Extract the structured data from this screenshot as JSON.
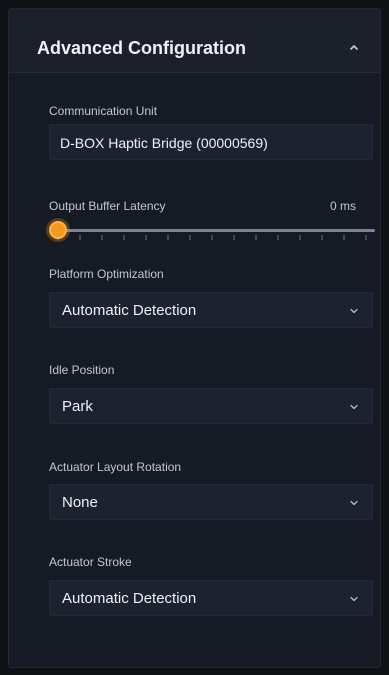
{
  "header": {
    "title": "Advanced Configuration",
    "collapse_icon": "chevron-up-icon"
  },
  "communication_unit": {
    "label": "Communication Unit",
    "value": "D-BOX Haptic Bridge (00000569)"
  },
  "output_buffer_latency": {
    "label": "Output Buffer Latency",
    "value_text": "0 ms",
    "value": 0,
    "min": 0,
    "tick_count": 15
  },
  "platform_optimization": {
    "label": "Platform Optimization",
    "selected": "Automatic Detection"
  },
  "idle_position": {
    "label": "Idle Position",
    "selected": "Park"
  },
  "actuator_layout_rotation": {
    "label": "Actuator Layout Rotation",
    "selected": "None"
  },
  "actuator_stroke": {
    "label": "Actuator Stroke",
    "selected": "Automatic Detection"
  },
  "colors": {
    "accent": "#f59a1c",
    "panel_bg": "#151a24",
    "field_bg": "#1c2230",
    "text_primary": "#eef1f6",
    "text_secondary": "#c2c7d0"
  }
}
